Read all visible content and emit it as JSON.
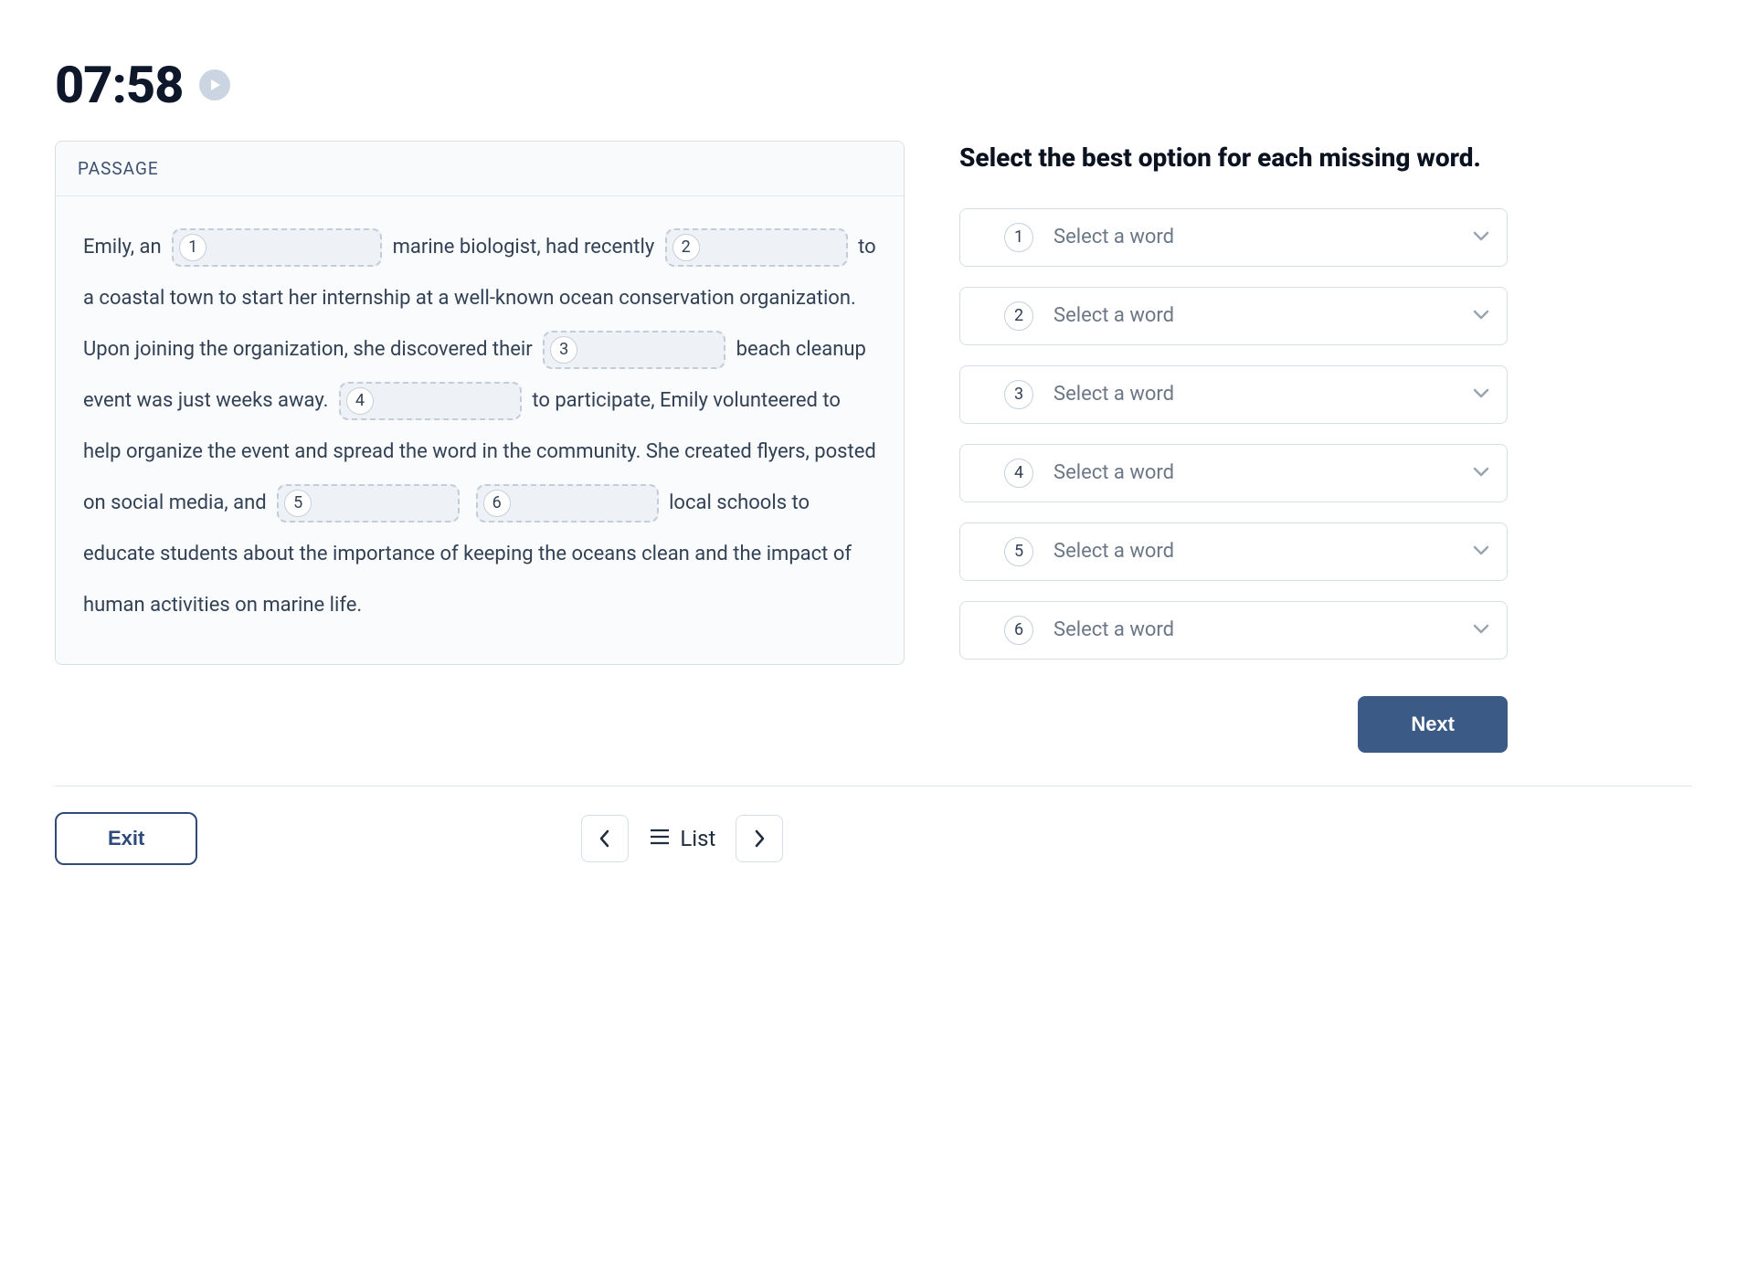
{
  "timer": {
    "value": "07:58"
  },
  "passage": {
    "header": "PASSAGE",
    "segments": [
      "Emily, an ",
      " marine biologist, had recently ",
      " to a coastal town to start her internship at a well-known ocean conservation organization. Upon joining the organization, she discovered their ",
      " beach cleanup event was just weeks away. ",
      " to participate, Emily volunteered to help organize the event and spread the word in the community. She created flyers, posted on social media, and ",
      " ",
      " local schools to educate students about the importance of keeping the oceans clean and the impact of human activities on marine life."
    ],
    "blankNumbers": [
      "1",
      "2",
      "3",
      "4",
      "5",
      "6"
    ],
    "blankWidths": [
      170,
      140,
      140,
      140,
      140,
      140
    ]
  },
  "instructions": "Select the best option for each missing word.",
  "selects": {
    "placeholder": "Select a word",
    "items": [
      {
        "num": "1"
      },
      {
        "num": "2"
      },
      {
        "num": "3"
      },
      {
        "num": "4"
      },
      {
        "num": "5"
      },
      {
        "num": "6"
      }
    ]
  },
  "buttons": {
    "next": "Next",
    "exit": "Exit",
    "list": "List"
  }
}
